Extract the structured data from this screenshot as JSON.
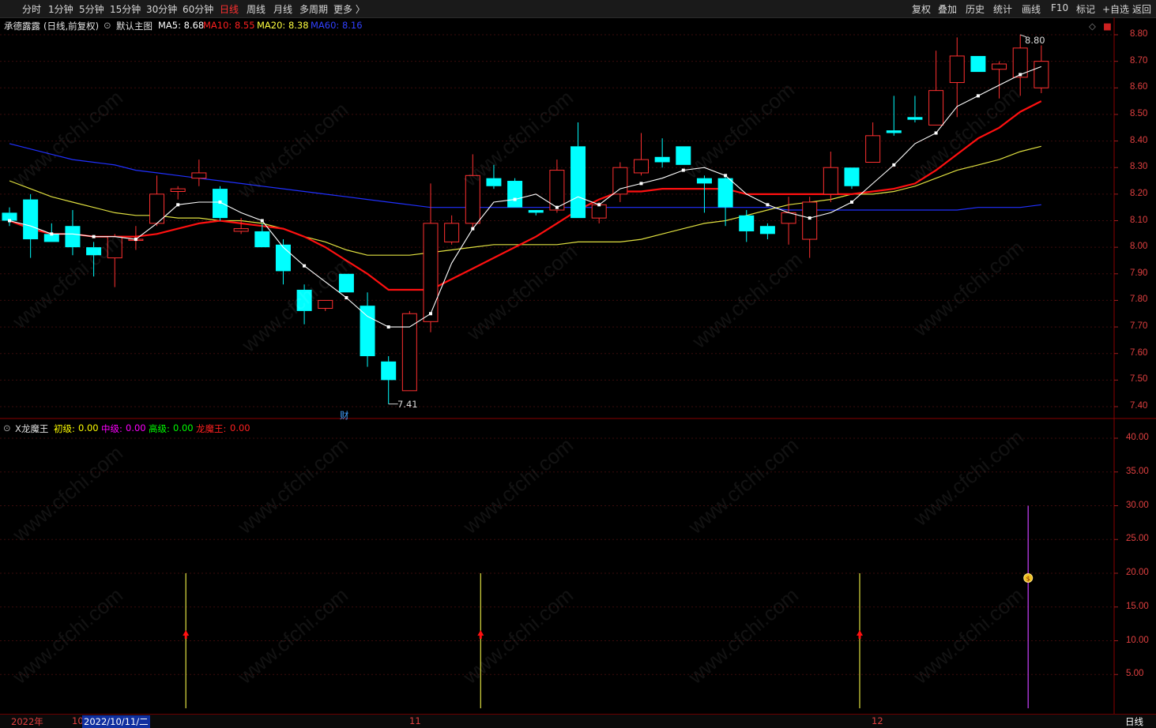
{
  "toolbar": {
    "periods": [
      "分时",
      "1分钟",
      "5分钟",
      "15分钟",
      "30分钟",
      "60分钟",
      "日线",
      "周线",
      "月线",
      "多周期",
      "更多 〉"
    ],
    "active_period": "日线",
    "right_tools": [
      "复权",
      "叠加",
      "历史",
      "统计",
      "画线",
      "F10",
      "标记",
      "+自选",
      "返回"
    ]
  },
  "main_panel": {
    "stock_name": "承德露露",
    "mode": "(日线,前复权)",
    "template": "默认主图",
    "ma_labels": [
      {
        "text": "MA5: 8.68",
        "color": "#ffffff"
      },
      {
        "text": "MA10: 8.55",
        "color": "#ff2020"
      },
      {
        "text": "MA20: 8.38",
        "color": "#ffff40"
      },
      {
        "text": "MA60: 8.16",
        "color": "#3040ff"
      }
    ],
    "high_mark": "8.80",
    "low_mark": "7.41",
    "finance_mark": "财",
    "y_ticks": [
      "8.80",
      "8.70",
      "8.60",
      "8.50",
      "8.40",
      "8.30",
      "8.20",
      "8.10",
      "8.00",
      "7.90",
      "7.80",
      "7.70",
      "7.60",
      "7.50",
      "7.40"
    ]
  },
  "indicator_panel": {
    "name": "X龙魔王",
    "labels": [
      {
        "text": "初级:",
        "color": "#ffff00"
      },
      {
        "text": "0.00",
        "color": "#ffff00"
      },
      {
        "text": "中级:",
        "color": "#ff00ff"
      },
      {
        "text": "0.00",
        "color": "#ff00ff"
      },
      {
        "text": "高级:",
        "color": "#00ff00"
      },
      {
        "text": "0.00",
        "color": "#00ff00"
      },
      {
        "text": "龙魔王:",
        "color": "#ff2020"
      },
      {
        "text": "0.00",
        "color": "#ff2020"
      }
    ],
    "y_ticks": [
      "40.00",
      "35.00",
      "30.00",
      "25.00",
      "20.00",
      "15.00",
      "10.00",
      "5.00"
    ]
  },
  "bottom_bar": {
    "year": "2022年",
    "month_10": "10",
    "date_cursor": "2022/10/11/二",
    "month_11": "11",
    "month_12": "12",
    "period": "日线"
  },
  "watermark": "www.cfchi.com",
  "chart_data": {
    "type": "candlestick",
    "candles": [
      [
        8.13,
        8.1,
        8.15,
        8.08
      ],
      [
        8.18,
        8.03,
        8.2,
        7.96
      ],
      [
        8.05,
        8.02,
        8.09,
        8.02
      ],
      [
        8.08,
        8.0,
        8.14,
        7.97
      ],
      [
        8.0,
        7.97,
        8.02,
        7.89
      ],
      [
        7.96,
        8.04,
        8.05,
        7.85
      ],
      [
        8.03,
        8.03,
        8.08,
        7.99
      ],
      [
        8.09,
        8.2,
        8.27,
        8.08
      ],
      [
        8.21,
        8.22,
        8.23,
        8.18
      ],
      [
        8.26,
        8.28,
        8.33,
        8.23
      ],
      [
        8.22,
        8.11,
        8.23,
        8.1
      ],
      [
        8.06,
        8.07,
        8.11,
        8.05
      ],
      [
        8.06,
        8.0,
        8.09,
        8.0
      ],
      [
        8.01,
        7.91,
        8.03,
        7.86
      ],
      [
        7.84,
        7.76,
        7.86,
        7.71
      ],
      [
        7.77,
        7.8,
        7.8,
        7.76
      ],
      [
        7.9,
        7.83,
        7.9,
        7.83
      ],
      [
        7.78,
        7.59,
        7.83,
        7.55
      ],
      [
        7.57,
        7.5,
        7.59,
        7.41
      ],
      [
        7.46,
        7.75,
        7.76,
        7.46
      ],
      [
        7.72,
        8.09,
        8.24,
        7.68
      ],
      [
        8.02,
        8.09,
        8.12,
        8.01
      ],
      [
        8.09,
        8.27,
        8.35,
        8.07
      ],
      [
        8.26,
        8.23,
        8.31,
        8.22
      ],
      [
        8.25,
        8.15,
        8.26,
        8.15
      ],
      [
        8.14,
        8.13,
        8.13,
        8.12
      ],
      [
        8.14,
        8.29,
        8.33,
        8.13
      ],
      [
        8.38,
        8.11,
        8.47,
        8.11
      ],
      [
        8.11,
        8.16,
        8.17,
        8.09
      ],
      [
        8.2,
        8.3,
        8.32,
        8.17
      ],
      [
        8.28,
        8.33,
        8.43,
        8.27
      ],
      [
        8.34,
        8.32,
        8.41,
        8.3
      ],
      [
        8.38,
        8.31,
        8.38,
        8.31
      ],
      [
        8.26,
        8.24,
        8.27,
        8.13
      ],
      [
        8.26,
        8.15,
        8.27,
        8.08
      ],
      [
        8.12,
        8.06,
        8.14,
        8.02
      ],
      [
        8.08,
        8.05,
        8.09,
        8.03
      ],
      [
        8.09,
        8.13,
        8.19,
        8.01
      ],
      [
        8.03,
        8.17,
        8.19,
        7.96
      ],
      [
        8.2,
        8.3,
        8.36,
        8.17
      ],
      [
        8.3,
        8.23,
        8.3,
        8.22
      ],
      [
        8.32,
        8.42,
        8.47,
        8.33
      ],
      [
        8.44,
        8.43,
        8.57,
        8.42
      ],
      [
        8.49,
        8.48,
        8.57,
        8.47
      ],
      [
        8.46,
        8.59,
        8.74,
        8.46
      ],
      [
        8.62,
        8.72,
        8.79,
        8.49
      ],
      [
        8.72,
        8.66,
        8.72,
        8.66
      ],
      [
        8.67,
        8.69,
        8.7,
        8.56
      ],
      [
        8.64,
        8.75,
        8.8,
        8.57
      ],
      [
        8.6,
        8.7,
        8.76,
        8.58
      ]
    ],
    "ma5": [
      8.1,
      8.08,
      8.05,
      8.05,
      8.04,
      8.04,
      8.03,
      8.09,
      8.16,
      8.17,
      8.17,
      8.13,
      8.1,
      8.0,
      7.93,
      7.87,
      7.81,
      7.74,
      7.7,
      7.7,
      7.75,
      7.94,
      8.07,
      8.17,
      8.18,
      8.2,
      8.15,
      8.19,
      8.16,
      8.22,
      8.24,
      8.26,
      8.29,
      8.3,
      8.27,
      8.2,
      8.16,
      8.13,
      8.11,
      8.13,
      8.17,
      8.24,
      8.31,
      8.39,
      8.43,
      8.53,
      8.57,
      8.61,
      8.65,
      8.68
    ],
    "ma10": [
      8.1,
      8.07,
      8.05,
      8.05,
      8.04,
      8.04,
      8.04,
      8.05,
      8.07,
      8.09,
      8.1,
      8.09,
      8.08,
      8.07,
      8.04,
      8.0,
      7.95,
      7.9,
      7.84,
      7.84,
      7.84,
      7.88,
      7.92,
      7.96,
      8.0,
      8.04,
      8.09,
      8.14,
      8.18,
      8.21,
      8.21,
      8.22,
      8.22,
      8.22,
      8.22,
      8.2,
      8.2,
      8.2,
      8.2,
      8.2,
      8.2,
      8.21,
      8.22,
      8.24,
      8.29,
      8.35,
      8.41,
      8.45,
      8.51,
      8.55
    ],
    "ma20": [
      8.25,
      8.22,
      8.19,
      8.17,
      8.15,
      8.13,
      8.12,
      8.12,
      8.11,
      8.11,
      8.1,
      8.1,
      8.09,
      8.07,
      8.04,
      8.02,
      7.99,
      7.97,
      7.97,
      7.97,
      7.98,
      7.99,
      8.0,
      8.01,
      8.01,
      8.01,
      8.01,
      8.02,
      8.02,
      8.02,
      8.03,
      8.05,
      8.07,
      8.09,
      8.1,
      8.12,
      8.14,
      8.16,
      8.17,
      8.18,
      8.2,
      8.2,
      8.21,
      8.23,
      8.26,
      8.29,
      8.31,
      8.33,
      8.36,
      8.38
    ],
    "ma60": [
      8.39,
      8.37,
      8.35,
      8.33,
      8.32,
      8.31,
      8.29,
      8.28,
      8.27,
      8.26,
      8.25,
      8.24,
      8.23,
      8.22,
      8.21,
      8.2,
      8.19,
      8.18,
      8.17,
      8.16,
      8.15,
      8.15,
      8.15,
      8.15,
      8.15,
      8.15,
      8.15,
      8.15,
      8.15,
      8.15,
      8.15,
      8.15,
      8.15,
      8.15,
      8.15,
      8.15,
      8.15,
      8.14,
      8.14,
      8.14,
      8.14,
      8.14,
      8.14,
      8.14,
      8.14,
      8.14,
      8.15,
      8.15,
      8.15,
      8.16
    ],
    "signals": [
      {
        "index": 8,
        "value": 20,
        "type": "初级"
      },
      {
        "index": 22,
        "value": 20,
        "type": "初级"
      },
      {
        "index": 40,
        "value": 20,
        "type": "初级"
      },
      {
        "index": 48,
        "value": 30,
        "type": "龙魔王"
      }
    ],
    "ylim_main": [
      7.36,
      8.86
    ],
    "ylim_indicator": [
      0,
      43
    ]
  }
}
